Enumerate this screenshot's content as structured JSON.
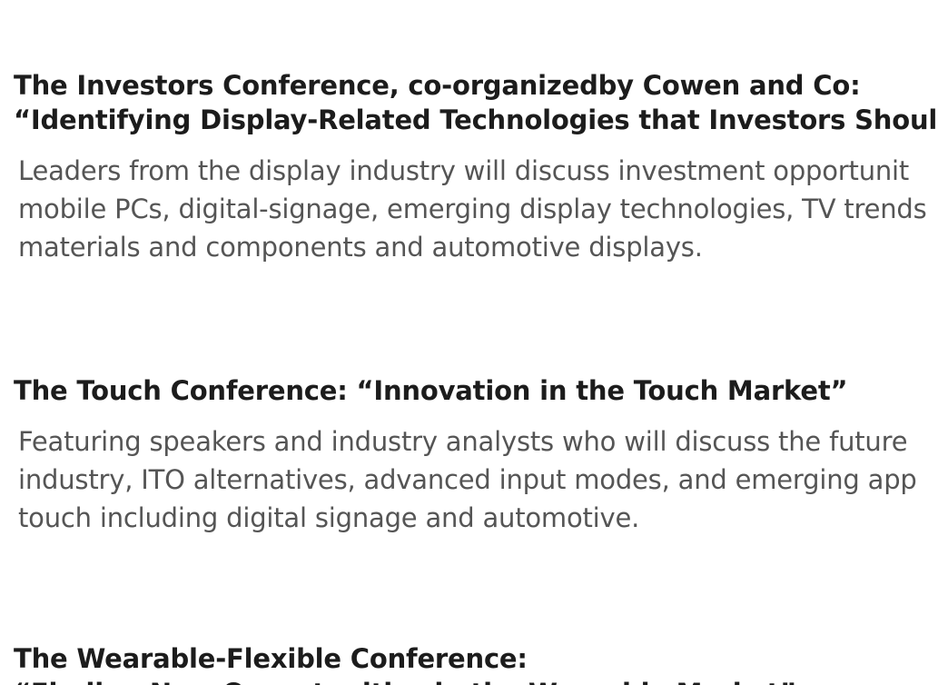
{
  "sections": [
    {
      "heading_lines": [
        "The Investors Conference, co-organizedby Cowen and Co:",
        "“Identifying Display-Related Technologies that Investors Should"
      ],
      "description_lines": [
        "Leaders from the display industry will discuss investment opportunit",
        "mobile PCs, digital-signage, emerging display technologies, TV trends",
        "materials and components and automotive displays."
      ]
    },
    {
      "heading_lines": [
        "The Touch Conference: “Innovation in the Touch Market”"
      ],
      "description_lines": [
        "Featuring speakers and industry analysts who will discuss the future",
        "industry, ITO alternatives, advanced input modes, and emerging app",
        "touch including digital signage and automotive."
      ]
    },
    {
      "heading_lines": [
        "The Wearable-Flexible Conference:",
        "“Finding New Opportunities in the Wearable Market”"
      ],
      "description_lines": []
    }
  ]
}
